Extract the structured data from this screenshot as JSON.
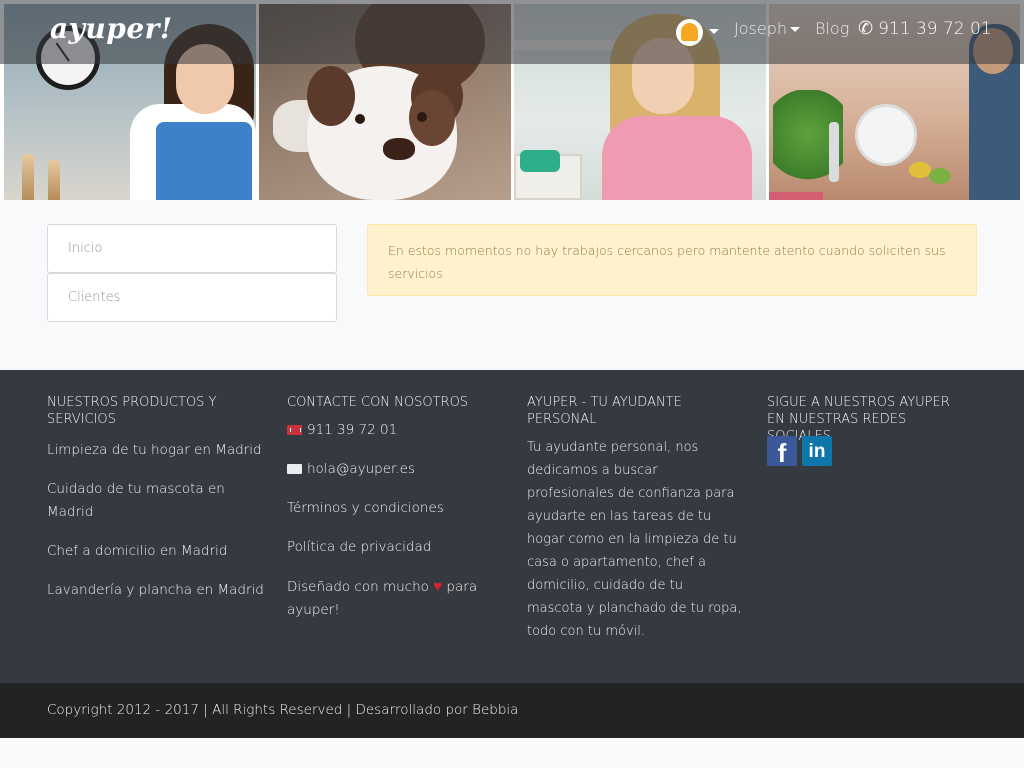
{
  "navbar": {
    "brand": "ayuper!",
    "user_name": "Joseph",
    "blog_label": "Blog",
    "phone": "911 39 72 01"
  },
  "sidebar": {
    "items": [
      {
        "label": "Inicio"
      },
      {
        "label": "Clientes"
      }
    ]
  },
  "alert": {
    "message": "En estos momentos no hay trabajos cercanos pero mantente atento cuando soliciten sus servicios"
  },
  "footer": {
    "products": {
      "heading": "Nuestros productos y servicios",
      "links": [
        "Limpieza de tu hogar en Madrid",
        "Cuidado de tu mascota en Madrid",
        "Chef a domicilio en Madrid",
        "Lavandería y plancha en Madrid"
      ]
    },
    "contact": {
      "heading": "Contacte con nosotros",
      "phone": "911 39 72 01",
      "email": "hola@ayuper.es",
      "terms": "Términos y condiciones",
      "privacy": "Política de privacidad",
      "designed_before": "Diseñado con mucho",
      "designed_after": "para ayuper!"
    },
    "about": {
      "heading": "Ayuper - Tu ayudante personal",
      "text": "Tu ayudante personal, nos dedicamos a buscar profesionales de confianza para ayudarte en las tareas de tu hogar como en la limpieza de tu casa o apartamento, chef a domicilio, cuidado de tu mascota y planchado de tu ropa, todo con tu móvil."
    },
    "social": {
      "heading": "Sigue a nuestros ayuper en nuestras redes sociales",
      "facebook_glyph": "f",
      "linkedin_glyph": "in"
    },
    "copyright": "Copyright 2012 - 2017 | All Rights Reserved | Desarrollado por Bebbia"
  },
  "colors": {
    "footer_bg": "#343a40",
    "copyright_bg": "#222325",
    "alert_bg": "#fff2cd",
    "heart": "#d9232e",
    "notification": "#f5a623"
  }
}
